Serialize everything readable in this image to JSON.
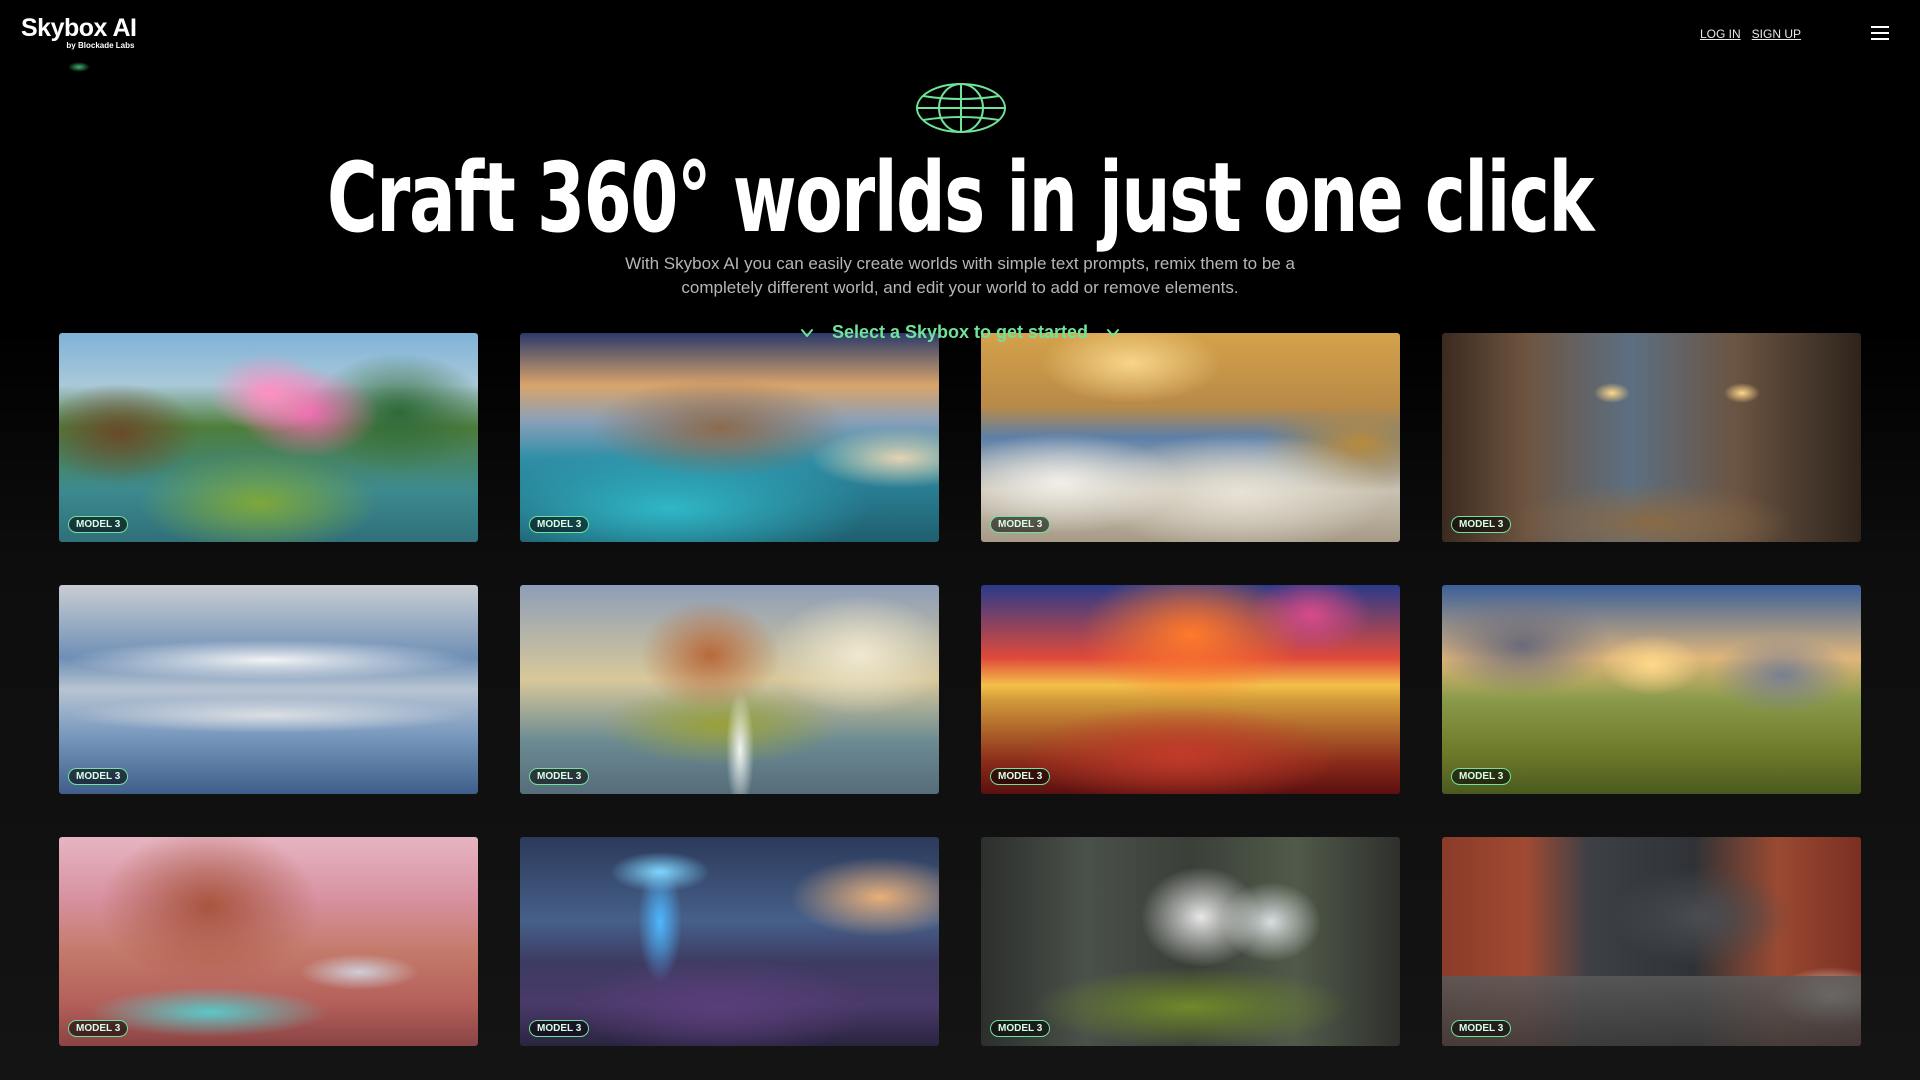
{
  "header": {
    "logo_main": "Skybox AI",
    "logo_sub": "by Blockade Labs",
    "login_label": "LOG IN",
    "signup_label": "SIGN UP",
    "menu_icon": "hamburger-menu-icon"
  },
  "hero": {
    "icon": "globe-icon",
    "title": "Craft 360° worlds in just one click",
    "subtitle": "With Skybox AI you can easily create worlds with simple text prompts, remix them to be a completely different world, and edit your world to add or remove elements.",
    "cta_label": "Select a Skybox to get started"
  },
  "colors": {
    "accent": "#6fe39a",
    "background": "#000000"
  },
  "gallery": {
    "cards": [
      {
        "badge": "MODEL 3"
      },
      {
        "badge": "MODEL 3"
      },
      {
        "badge": "MODEL 3"
      },
      {
        "badge": "MODEL 3"
      },
      {
        "badge": "MODEL 3"
      },
      {
        "badge": "MODEL 3"
      },
      {
        "badge": "MODEL 3"
      },
      {
        "badge": "MODEL 3"
      },
      {
        "badge": "MODEL 3"
      },
      {
        "badge": "MODEL 3"
      },
      {
        "badge": "MODEL 3"
      },
      {
        "badge": "MODEL 3"
      }
    ]
  }
}
